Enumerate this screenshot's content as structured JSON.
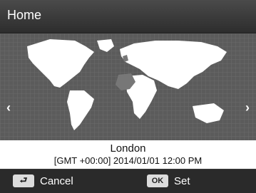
{
  "header": {
    "title": "Home"
  },
  "map": {
    "highlight_color": "#777777",
    "land_color": "#ffffff",
    "background_color": "#5b5b5b"
  },
  "location": {
    "city": "London",
    "detail": "[GMT +00:00] 2014/01/01 12:00 PM"
  },
  "nav": {
    "left_icon": "chevron-left",
    "right_icon": "chevron-right"
  },
  "bottom": {
    "cancel_label": "Cancel",
    "set_label": "Set",
    "ok_key": "OK",
    "back_icon": "return-arrow"
  }
}
